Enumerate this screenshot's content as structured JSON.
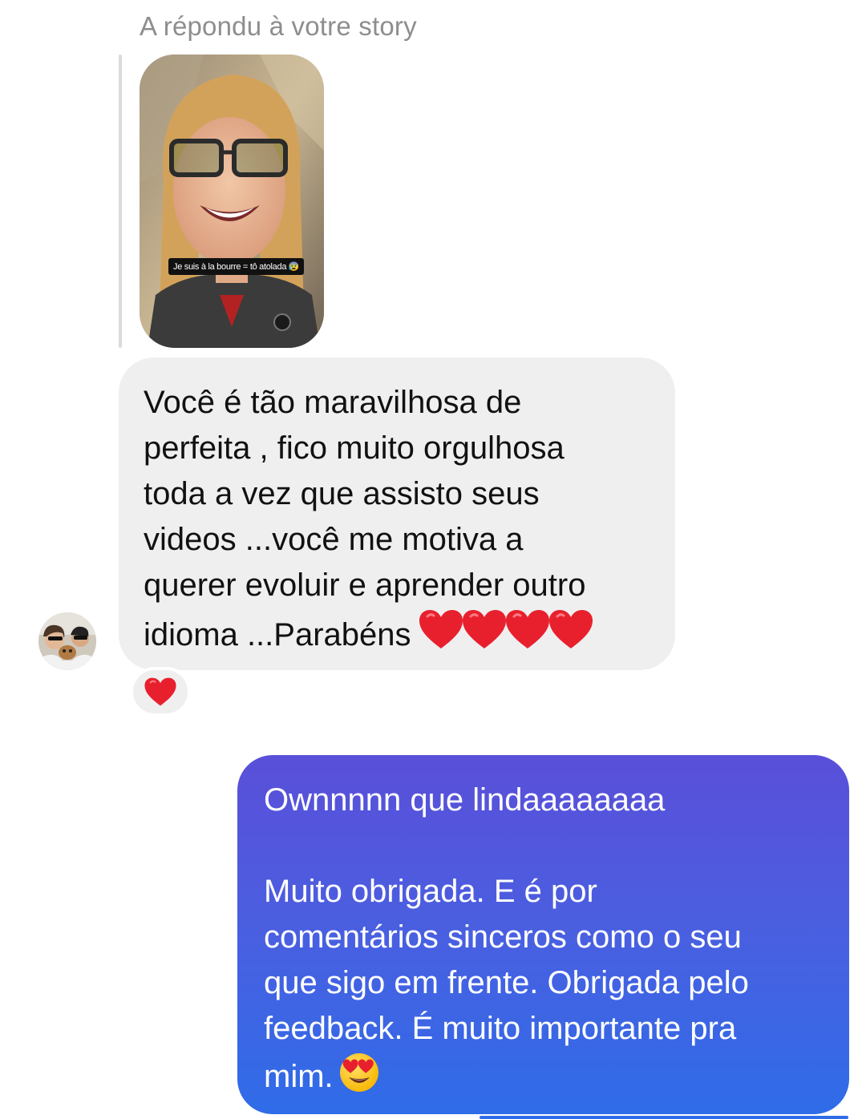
{
  "story_reply": {
    "label": "A répondu à votre story",
    "story_caption": "Je suis à la bourre = tô atolada"
  },
  "incoming_message": {
    "text": "Você é tão maravilhosa de\nperfeita , fico muito orgulhosa\ntoda a vez que assisto seus\nvideos ...você  me motiva a\nquerer evoluir e aprender outro\nidioma ...Parabéns",
    "trailing_emoji": "red-heart x4",
    "reaction": "red-heart"
  },
  "outgoing_message": {
    "text": "Ownnnnn que lindaaaaaaaa\n\nMuito obrigada. E é por\ncomentários sinceros como o seu\nque sigo em frente. Obrigada pelo\nfeedback. É muito importante pra\nmim.",
    "trailing_emoji": "heart-eyes-face"
  },
  "colors": {
    "incoming_bubble": "#efefef",
    "outgoing_gradient_top": "#5a4fd9",
    "outgoing_gradient_bottom": "#2f6ce8",
    "meta_text": "#8e8e8e",
    "heart": "#e8202e"
  }
}
